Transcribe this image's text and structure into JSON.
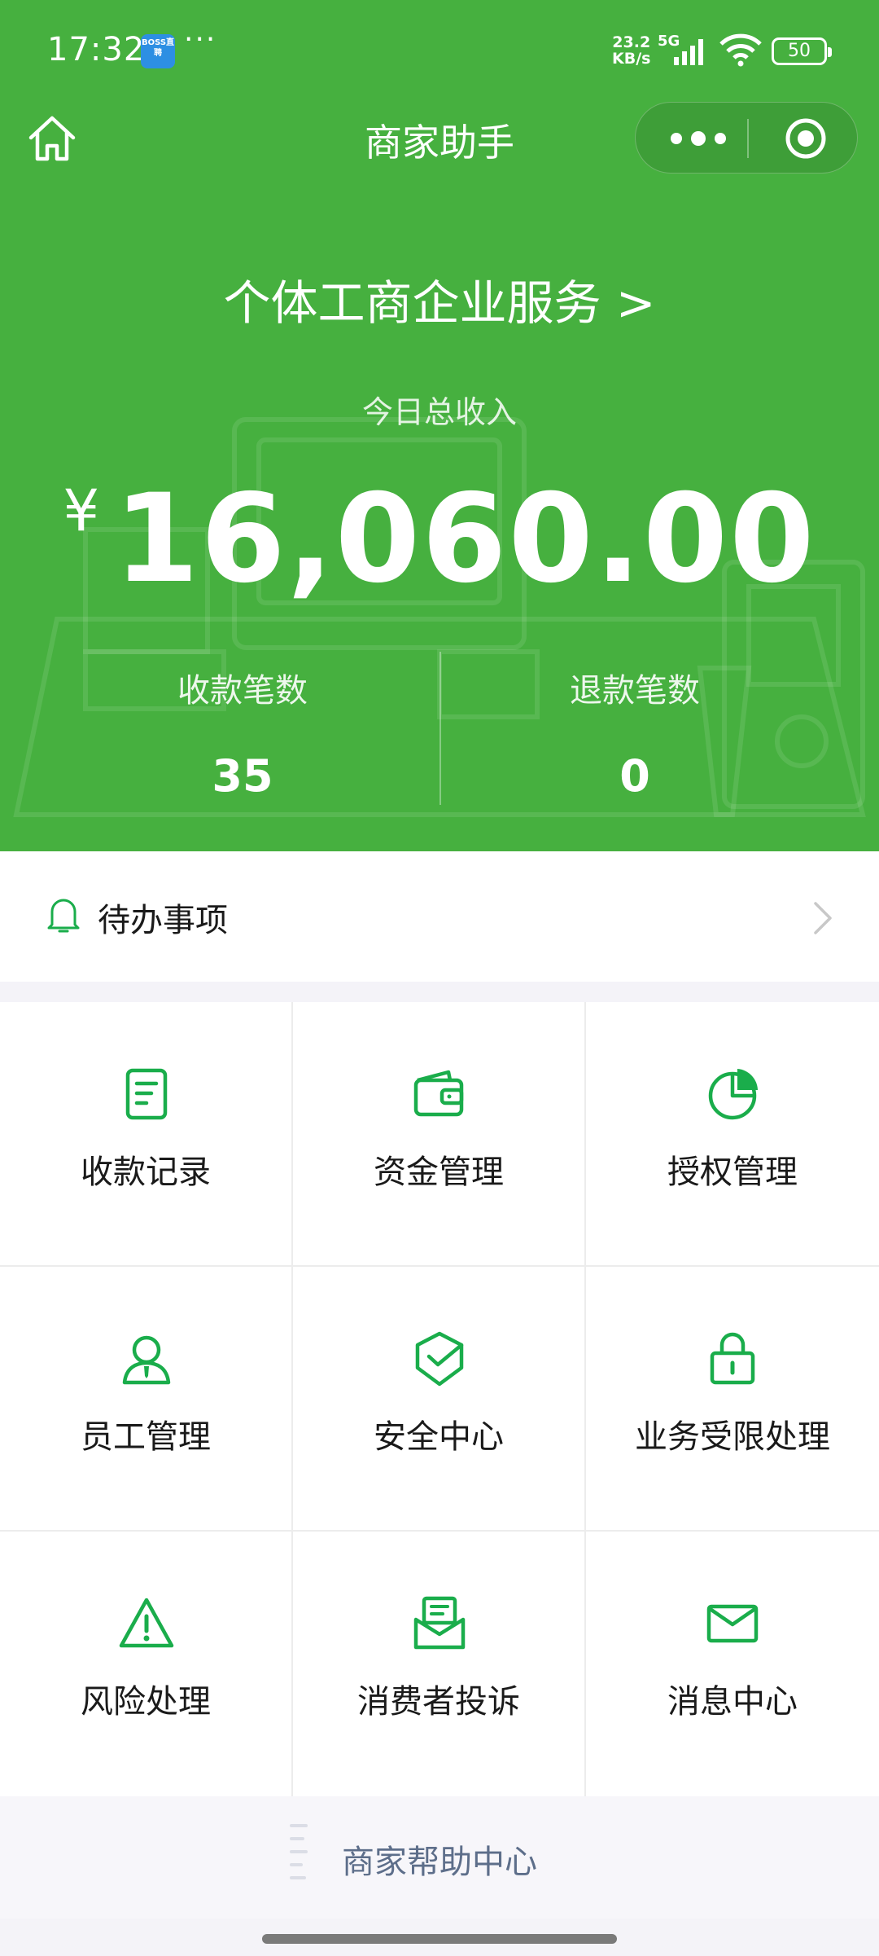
{
  "status_bar": {
    "time": "17:32",
    "app_badge": "BOSS直聘",
    "more": "···",
    "net_speed_value": "23.2",
    "net_speed_unit": "KB/s",
    "network": "5G",
    "battery": "50"
  },
  "nav": {
    "title": "商家助手",
    "home_icon": "home-icon",
    "more_icon": "more-dots-icon",
    "close_icon": "target-close-icon"
  },
  "hero": {
    "service_link": "个体工商企业服务 >",
    "income_label": "今日总收入",
    "currency": "¥",
    "amount": "16,060.00",
    "stats": [
      {
        "label": "收款笔数",
        "value": "35"
      },
      {
        "label": "退款笔数",
        "value": "0"
      }
    ]
  },
  "todo": {
    "label": "待办事项",
    "icon": "bell-icon"
  },
  "grid": [
    {
      "label": "收款记录",
      "icon": "receipt-icon"
    },
    {
      "label": "资金管理",
      "icon": "wallet-icon"
    },
    {
      "label": "授权管理",
      "icon": "pie-chart-icon"
    },
    {
      "label": "员工管理",
      "icon": "staff-icon"
    },
    {
      "label": "安全中心",
      "icon": "shield-check-icon"
    },
    {
      "label": "业务受限处理",
      "icon": "lock-icon"
    },
    {
      "label": "风险处理",
      "icon": "warning-icon"
    },
    {
      "label": "消费者投诉",
      "icon": "complaint-mail-icon"
    },
    {
      "label": "消息中心",
      "icon": "envelope-icon"
    }
  ],
  "help": {
    "label": "商家帮助中心"
  },
  "colors": {
    "brand_green": "#46b03f",
    "icon_green": "#1aad4b",
    "help_text": "#5d6e8a"
  }
}
